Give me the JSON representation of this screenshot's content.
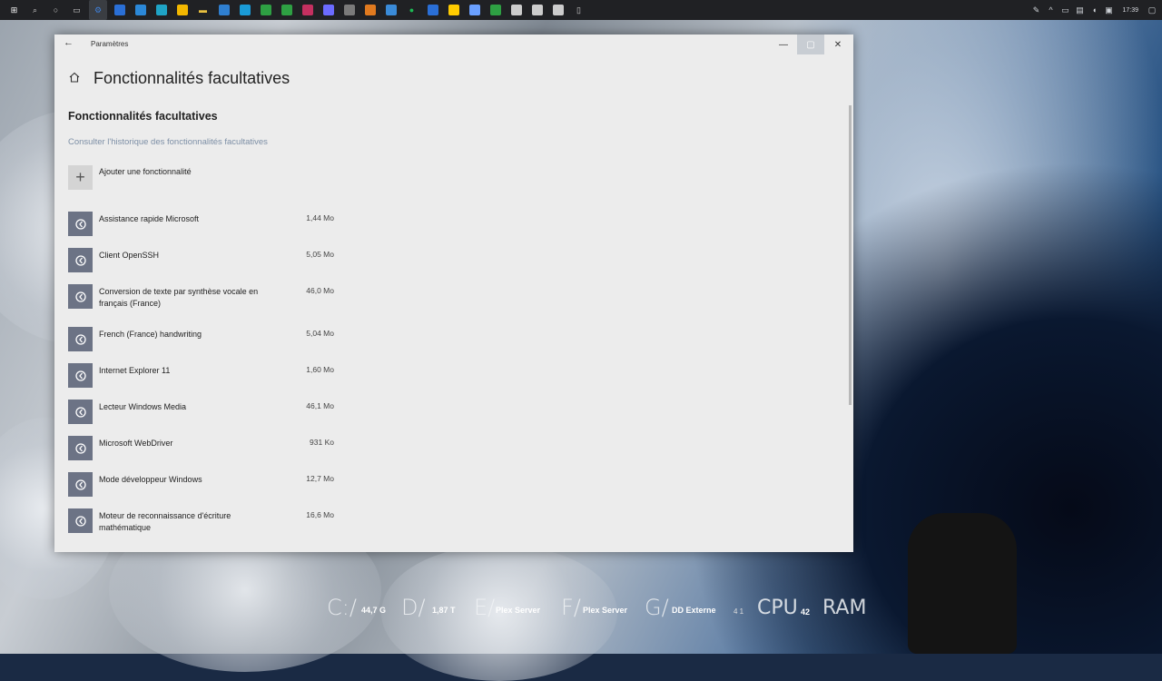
{
  "window": {
    "title": "Paramètres",
    "page_title": "Fonctionnalités facultatives",
    "section_title": "Fonctionnalités facultatives",
    "history_link": "Consulter l'historique des fonctionnalités facultatives",
    "add_feature_label": "Ajouter une fonctionnalité"
  },
  "features": [
    {
      "name": "Assistance rapide Microsoft",
      "size": "1,44 Mo"
    },
    {
      "name": "Client OpenSSH",
      "size": "5,05 Mo"
    },
    {
      "name": "Conversion de texte par synthèse vocale en français (France)",
      "size": "46,0 Mo"
    },
    {
      "name": "French (France) handwriting",
      "size": "5,04 Mo"
    },
    {
      "name": "Internet Explorer 11",
      "size": "1,60 Mo"
    },
    {
      "name": "Lecteur Windows Media",
      "size": "46,1 Mo"
    },
    {
      "name": "Microsoft WebDriver",
      "size": "931 Ko"
    },
    {
      "name": "Mode développeur Windows",
      "size": "12,7 Mo"
    },
    {
      "name": "Moteur de reconnaissance d'écriture mathématique",
      "size": "16,6 Mo"
    }
  ],
  "taskbar": {
    "time": "17:39",
    "icons": [
      "windows-icon",
      "search-icon",
      "cortana-icon",
      "task-view-icon",
      "settings-icon",
      "app-icon-1",
      "app-icon-2",
      "app-icon-3",
      "app-icon-4",
      "folder-icon",
      "app-icon-5",
      "app-icon-6",
      "app-icon-7",
      "app-icon-8",
      "app-icon-9",
      "app-icon-10",
      "app-icon-11",
      "app-icon-12",
      "app-icon-13",
      "spotify-icon",
      "app-icon-14",
      "app-icon-15",
      "app-icon-16",
      "app-icon-17",
      "app-icon-18",
      "app-icon-19",
      "app-icon-20",
      "trash-icon"
    ],
    "icon_colors": [
      "#ffffff",
      "#cccccc",
      "#cccccc",
      "#cccccc",
      "#3f7fd8",
      "#2a6fd6",
      "#2b88d8",
      "#1fa4c6",
      "#f2b700",
      "#e8c040",
      "#2f7fd0",
      "#1a9bd7",
      "#2ea043",
      "#2ea043",
      "#c43060",
      "#6b6bff",
      "#7a7a7a",
      "#e07a1f",
      "#3a8bd8",
      "#1db954",
      "#2a6fd6",
      "#ffcc00",
      "#6aa0ff",
      "#2ea043",
      "#cccccc",
      "#cccccc",
      "#cccccc",
      "#cccccc"
    ]
  },
  "widgets": {
    "drives": [
      {
        "letter": "C:/",
        "label": "44,7 G"
      },
      {
        "letter": "D/",
        "label": "1,87 T"
      },
      {
        "letter": "E/",
        "label": "Plex Server"
      },
      {
        "letter": "F/",
        "label": "Plex Server"
      },
      {
        "letter": "G/",
        "label": "DD Externe"
      }
    ],
    "cpu_label": "CPU",
    "cpu_value": "42",
    "ram_label": "RAM",
    "extra_value": "4 1"
  }
}
